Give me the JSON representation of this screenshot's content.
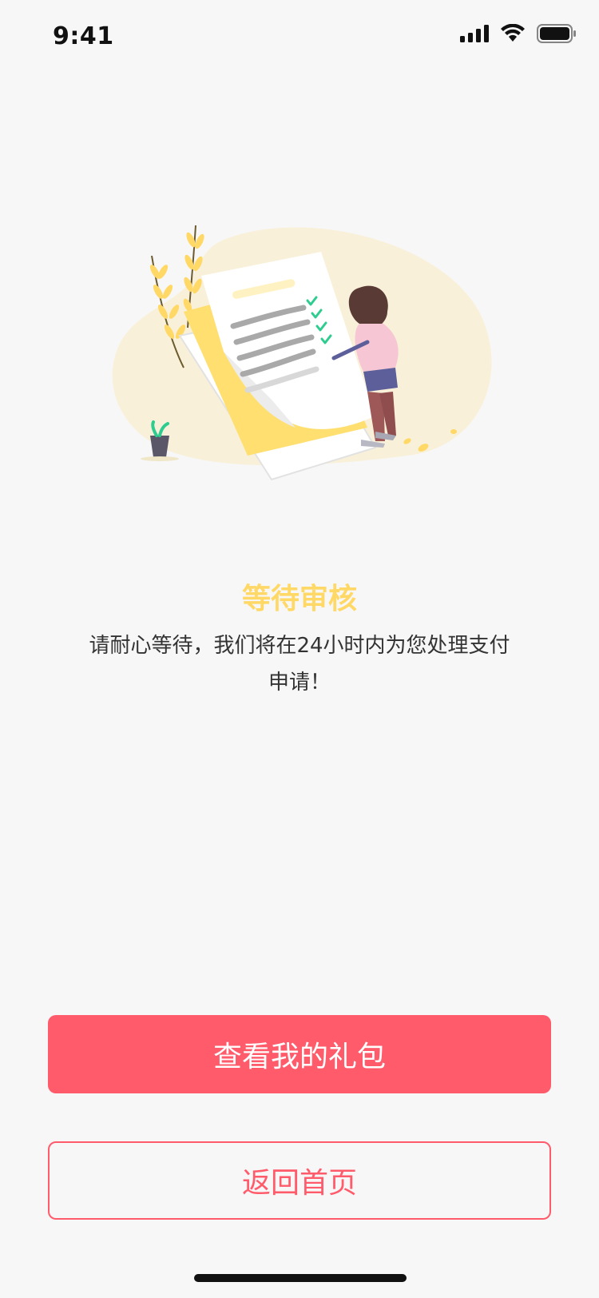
{
  "status_bar": {
    "time": "9:41",
    "icons": [
      "signal-icon",
      "wifi-icon",
      "battery-icon"
    ]
  },
  "illustration": {
    "name": "document-review-illustration"
  },
  "content": {
    "title": "等待审核",
    "description": "请耐心等待，我们将在24小时内为您处理支付申请！"
  },
  "buttons": {
    "view_gift": "查看我的礼包",
    "back_home": "返回首页"
  },
  "colors": {
    "background": "#f7f7f7",
    "accent": "#ff5b6b",
    "title": "#ffd866",
    "text": "#333333"
  }
}
